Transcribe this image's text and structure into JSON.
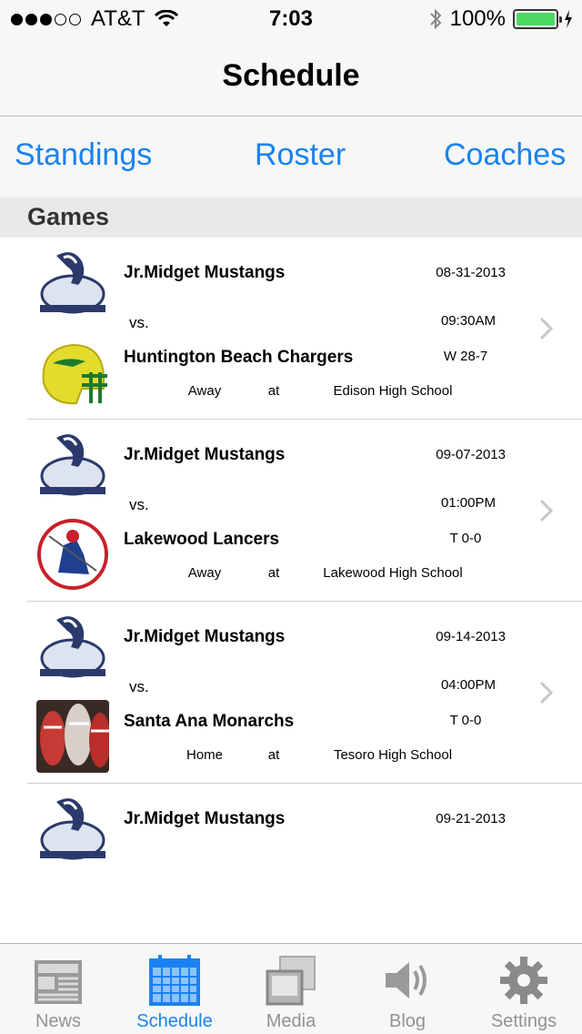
{
  "status_bar": {
    "carrier": "AT&T",
    "time": "7:03",
    "battery": "100%",
    "signal_full": 3,
    "signal_total": 5
  },
  "nav": {
    "title": "Schedule"
  },
  "segments": [
    {
      "label": "Standings"
    },
    {
      "label": "Roster"
    },
    {
      "label": "Coaches"
    }
  ],
  "section": {
    "title": "Games"
  },
  "games": [
    {
      "home_team": "Jr.Midget Mustangs",
      "vs": "vs.",
      "opponent": "Huntington Beach Chargers",
      "date": "08-31-2013",
      "time": "09:30AM",
      "result": "W 28-7",
      "side": "Away",
      "at": "at",
      "venue": "Edison  High School",
      "opponent_logo": "helmet-logo"
    },
    {
      "home_team": "Jr.Midget Mustangs",
      "vs": "vs.",
      "opponent": "Lakewood Lancers",
      "date": "09-07-2013",
      "time": "01:00PM",
      "result": "T 0-0",
      "side": "Away",
      "at": "at",
      "venue": "Lakewood High School",
      "opponent_logo": "lancer-logo"
    },
    {
      "home_team": "Jr.Midget Mustangs",
      "vs": "vs.",
      "opponent": "Santa Ana Monarchs",
      "date": "09-14-2013",
      "time": "04:00PM",
      "result": "T 0-0",
      "side": "Home",
      "at": "at",
      "venue": "Tesoro High School",
      "opponent_logo": "monarchs-photo"
    },
    {
      "home_team": "Jr.Midget Mustangs",
      "date": "09-21-2013"
    }
  ],
  "tabs": [
    {
      "label": "News",
      "icon": "newspaper-icon",
      "active": false
    },
    {
      "label": "Schedule",
      "icon": "calendar-icon",
      "active": true
    },
    {
      "label": "Media",
      "icon": "media-icon",
      "active": false
    },
    {
      "label": "Blog",
      "icon": "speaker-icon",
      "active": false
    },
    {
      "label": "Settings",
      "icon": "gear-icon",
      "active": false
    }
  ],
  "colors": {
    "accent": "#1a82f0",
    "bar_bg": "#f7f7f7",
    "section_bg": "#e9e9e9",
    "tab_inactive": "#929292",
    "battery": "#4cd964"
  }
}
